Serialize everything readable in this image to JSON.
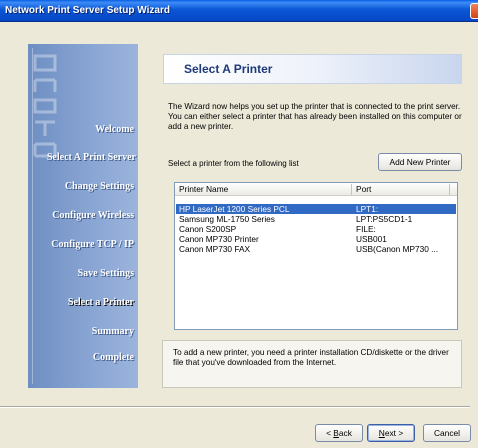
{
  "window": {
    "title": "Network Print Server Setup Wizard"
  },
  "sidebar": {
    "steps": [
      {
        "label": "Welcome"
      },
      {
        "label": "Select A Print Server"
      },
      {
        "label": "Change Settings"
      },
      {
        "label": "Configure Wireless"
      },
      {
        "label": "Configure TCP / IP"
      },
      {
        "label": "Save Settings"
      },
      {
        "label": "Select a Printer"
      },
      {
        "label": "Summary"
      },
      {
        "label": "Complete"
      }
    ],
    "current_step": "Select a Printer"
  },
  "header": {
    "title": "Select A Printer"
  },
  "description": "The Wizard now helps you set up the printer that is connected to the print server. You can either select a printer that has already been installed on this computer or add a new printer.",
  "printer_list": {
    "label": "Select a printer from the following list",
    "add_button": "Add New Printer",
    "columns": [
      "Printer Name",
      "Port"
    ],
    "rows": [
      {
        "name": "HP LaserJet 1200 Series PCL",
        "port": "LPT1:",
        "selected": true
      },
      {
        "name": "Samsung ML-1750 Series",
        "port": "LPT:PS5CD1-1"
      },
      {
        "name": "Canon S200SP",
        "port": "FILE:"
      },
      {
        "name": "Canon MP730 Printer",
        "port": "USB001"
      },
      {
        "name": "Canon MP730 FAX",
        "port": "USB(Canon MP730 ..."
      }
    ]
  },
  "info": {
    "text": "To add a new printer, you need a printer installation CD/diskette or the driver file that you've downloaded from the Internet."
  },
  "footer": {
    "back": {
      "prefix": "< ",
      "accel": "B",
      "rest": "ack"
    },
    "next": {
      "accel": "N",
      "rest": "ext >"
    },
    "cancel": "Cancel"
  }
}
